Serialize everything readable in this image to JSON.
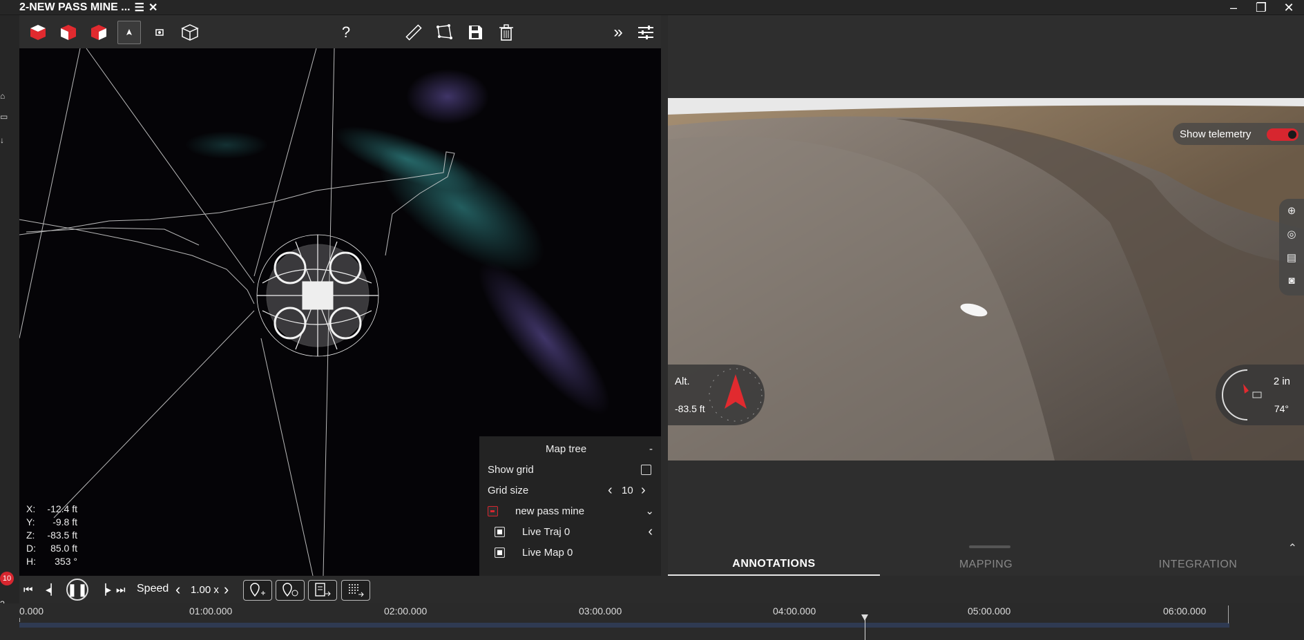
{
  "window": {
    "title": "2-NEW PASS MINE ...",
    "minimize_icon": "minimize-icon",
    "restore_icon": "restore-icon",
    "close_icon": "close-icon"
  },
  "toolbar": {
    "help_label": "?"
  },
  "coords": {
    "x_label": "X:",
    "x_value": "-12.4 ft",
    "y_label": "Y:",
    "y_value": "-9.8 ft",
    "z_label": "Z:",
    "z_value": "-83.5 ft",
    "d_label": "D:",
    "d_value": "85.0 ft",
    "h_label": "H:",
    "h_value": "353 °"
  },
  "map_tree": {
    "title": "Map tree",
    "collapse_label": "-",
    "show_grid_label": "Show grid",
    "show_grid_checked": false,
    "grid_size_label": "Grid size",
    "grid_size_value": "10",
    "root_item": "new pass mine",
    "children": [
      "Live Traj 0",
      "Live Map 0"
    ]
  },
  "video": {
    "show_telemetry_label": "Show telemetry",
    "show_telemetry_on": true,
    "alt_label": "Alt.",
    "alt_value": "-83.5 ft",
    "zoom_value": "2 in",
    "angle_value": "74°"
  },
  "tabs": [
    "ANNOTATIONS",
    "MAPPING",
    "INTEGRATION"
  ],
  "active_tab": "ANNOTATIONS",
  "playback": {
    "speed_label": "Speed",
    "speed_value": "1.00 x",
    "notification_count": "10"
  },
  "timeline": {
    "labels": [
      "0.000",
      "01:00.000",
      "02:00.000",
      "03:00.000",
      "04:00.000",
      "05:00.000",
      "06:00.000"
    ]
  },
  "colors": {
    "accent": "#d7262f",
    "panel": "#2b2b2b",
    "timeline_bar": "#2f3a52"
  }
}
